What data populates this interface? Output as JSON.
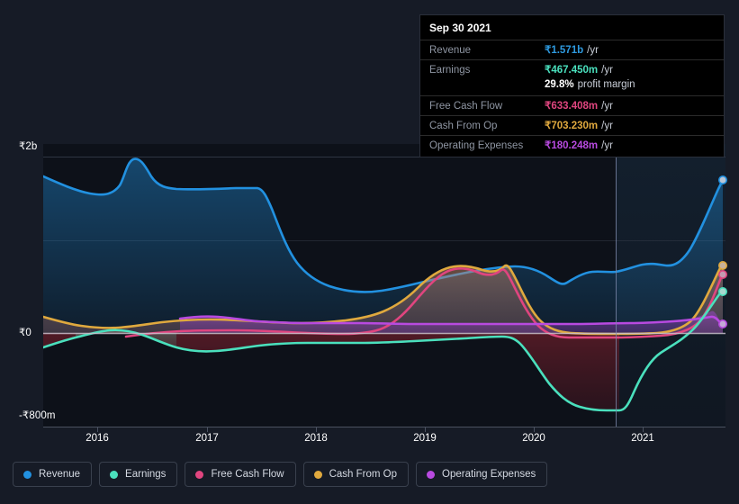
{
  "tooltip": {
    "date": "Sep 30 2021",
    "rows": [
      {
        "label": "Revenue",
        "value": "₹1.571b",
        "unit": "/yr",
        "color": "#2e9ae0"
      },
      {
        "label": "Earnings",
        "value": "₹467.450m",
        "unit": "/yr",
        "color": "#4ae0bd"
      },
      {
        "label": "Free Cash Flow",
        "value": "₹633.408m",
        "unit": "/yr",
        "color": "#e0457f"
      },
      {
        "label": "Cash From Op",
        "value": "₹703.230m",
        "unit": "/yr",
        "color": "#e0a93e"
      },
      {
        "label": "Operating Expenses",
        "value": "₹180.248m",
        "unit": "/yr",
        "color": "#b84ae0"
      }
    ],
    "profit_margin_value": "29.8%",
    "profit_margin_text": "profit margin"
  },
  "legend": {
    "items": [
      {
        "label": "Revenue",
        "color": "#2291e0"
      },
      {
        "label": "Earnings",
        "color": "#4ae0bd"
      },
      {
        "label": "Free Cash Flow",
        "color": "#e0457f"
      },
      {
        "label": "Cash From Op",
        "color": "#e0a93e"
      },
      {
        "label": "Operating Expenses",
        "color": "#b84ae0"
      }
    ]
  },
  "axes": {
    "y_top": "₹2b",
    "y_zero": "₹0",
    "y_bottom": "-₹800m",
    "x_ticks": [
      "2016",
      "2017",
      "2018",
      "2019",
      "2020",
      "2021"
    ]
  },
  "chart_data": {
    "type": "area",
    "title": "",
    "xlabel": "",
    "ylabel": "",
    "ylim": [
      -800000000,
      2000000000
    ],
    "y_ticks": [
      2000000000,
      0,
      -800000000
    ],
    "y_tick_labels": [
      "₹2b",
      "₹0",
      "-₹800m"
    ],
    "x_tick_labels": [
      "2016",
      "2017",
      "2018",
      "2019",
      "2020",
      "2021"
    ],
    "grid": true,
    "legend_position": "bottom",
    "currency": "INR",
    "cursor_date": "Sep 30 2021",
    "series": [
      {
        "name": "Revenue",
        "color": "#2291e0",
        "x": [
          "2015.6",
          "2015.9",
          "2016.2",
          "2016.35",
          "2016.5",
          "2016.75",
          "2017.0",
          "2017.4",
          "2017.75",
          "2017.9",
          "2018.1",
          "2018.5",
          "2018.9",
          "2019.2",
          "2019.5",
          "2019.75",
          "2020.0",
          "2020.25",
          "2020.5",
          "2020.75",
          "2021.0",
          "2021.3",
          "2021.55",
          "2021.75"
        ],
        "values": [
          1.86,
          1.72,
          1.64,
          1.72,
          2.01,
          1.72,
          1.61,
          1.6,
          1.62,
          1.34,
          1.08,
          0.92,
          0.8,
          0.79,
          0.8,
          0.86,
          0.9,
          0.8,
          0.84,
          0.86,
          0.9,
          0.92,
          1.1,
          1.571
        ],
        "value_unit": "billion INR",
        "endpoint_label": "₹1.571b"
      },
      {
        "name": "Earnings",
        "color": "#4ae0bd",
        "x": [
          "2015.6",
          "2015.9",
          "2016.2",
          "2016.5",
          "2016.8",
          "2017.1",
          "2017.5",
          "2017.9",
          "2018.2",
          "2018.6",
          "2019.0",
          "2019.4",
          "2019.7",
          "2020.0",
          "2020.2",
          "2020.45",
          "2020.7",
          "2021.0",
          "2021.25",
          "2021.5",
          "2021.75"
        ],
        "values": [
          -0.06,
          0.03,
          0.09,
          0.05,
          -0.02,
          -0.08,
          -0.12,
          -0.12,
          -0.1,
          -0.09,
          -0.08,
          -0.07,
          -0.07,
          -0.3,
          -0.58,
          -0.72,
          -0.76,
          -0.76,
          -0.32,
          -0.12,
          0.467
        ],
        "value_unit": "billion INR",
        "endpoint_label": "₹467.450m"
      },
      {
        "name": "Free Cash Flow",
        "color": "#e0457f",
        "x": [
          "2016.55",
          "2016.9",
          "2017.3",
          "2017.8",
          "2018.3",
          "2018.8",
          "2019.2",
          "2019.5",
          "2019.7",
          "2019.9",
          "2020.1",
          "2020.4",
          "2020.8",
          "2021.2",
          "2021.5",
          "2021.75"
        ],
        "values": [
          -0.03,
          0.0,
          0.01,
          0.0,
          -0.02,
          -0.03,
          0.05,
          0.35,
          0.62,
          0.5,
          0.1,
          -0.03,
          -0.04,
          -0.02,
          0.2,
          0.633
        ],
        "value_unit": "billion INR",
        "endpoint_label": "₹633.408m"
      },
      {
        "name": "Cash From Op",
        "color": "#e0a93e",
        "x": [
          "2015.6",
          "2015.95",
          "2016.35",
          "2016.8",
          "2017.2",
          "2017.6",
          "2018.0",
          "2018.4",
          "2018.8",
          "2019.1",
          "2019.4",
          "2019.65",
          "2019.85",
          "2020.05",
          "2020.3",
          "2020.6",
          "2021.0",
          "2021.3",
          "2021.55",
          "2021.75"
        ],
        "values": [
          0.1,
          0.07,
          0.04,
          0.03,
          0.04,
          0.06,
          0.07,
          0.07,
          0.08,
          0.12,
          0.42,
          0.68,
          0.56,
          0.16,
          0.0,
          -0.02,
          -0.02,
          0.01,
          0.25,
          0.703
        ],
        "value_unit": "billion INR",
        "endpoint_label": "₹703.230m"
      },
      {
        "name": "Operating Expenses",
        "color": "#b84ae0",
        "x": [
          "2016.85",
          "2017.2",
          "2017.6",
          "2018.0",
          "2018.5",
          "2019.0",
          "2019.5",
          "2020.0",
          "2020.5",
          "2021.0",
          "2021.4",
          "2021.75"
        ],
        "values": [
          0.085,
          0.095,
          0.09,
          0.08,
          0.075,
          0.072,
          0.075,
          0.08,
          0.082,
          0.085,
          0.095,
          0.18
        ],
        "value_unit": "billion INR",
        "endpoint_label": "₹180.248m"
      }
    ]
  }
}
